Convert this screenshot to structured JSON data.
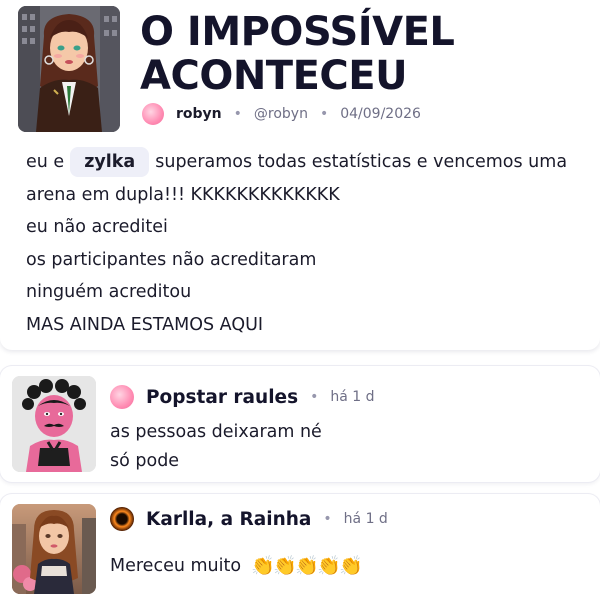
{
  "post": {
    "title": "O IMPOSSÍVEL ACONTECEU",
    "author": {
      "name": "robyn",
      "handle": "@robyn",
      "date": "04/09/2026"
    },
    "body": {
      "line1_before": "eu e",
      "mention": "zylka",
      "line1_after": "superamos todas estatísticas e vencemos uma",
      "line2": "arena em dupla!!! KKKKKKKKKKKKK",
      "line3": "eu não acreditei",
      "line4": "os participantes não acreditaram",
      "line5": "ninguém acreditou",
      "line6": "MAS AINDA ESTAMOS AQUI"
    }
  },
  "comments": [
    {
      "name": "Popstar raules",
      "time": "há 1 d",
      "lines": [
        "as pessoas deixaram né",
        "só pode"
      ],
      "badge": "pink-blob-icon"
    },
    {
      "name": "Karlla, a Rainha",
      "time": "há 1 d",
      "text": "Mereceu muito",
      "emoji": [
        "👏",
        "👏",
        "👏",
        "👏",
        "👏"
      ],
      "badge": "fire-ring-icon"
    }
  ],
  "separator": "•",
  "colors": {
    "text": "#1b1b2b",
    "muted": "#6f6f86",
    "mention_bg": "#eeeff8",
    "accent_pink": "#ff8cb3"
  }
}
